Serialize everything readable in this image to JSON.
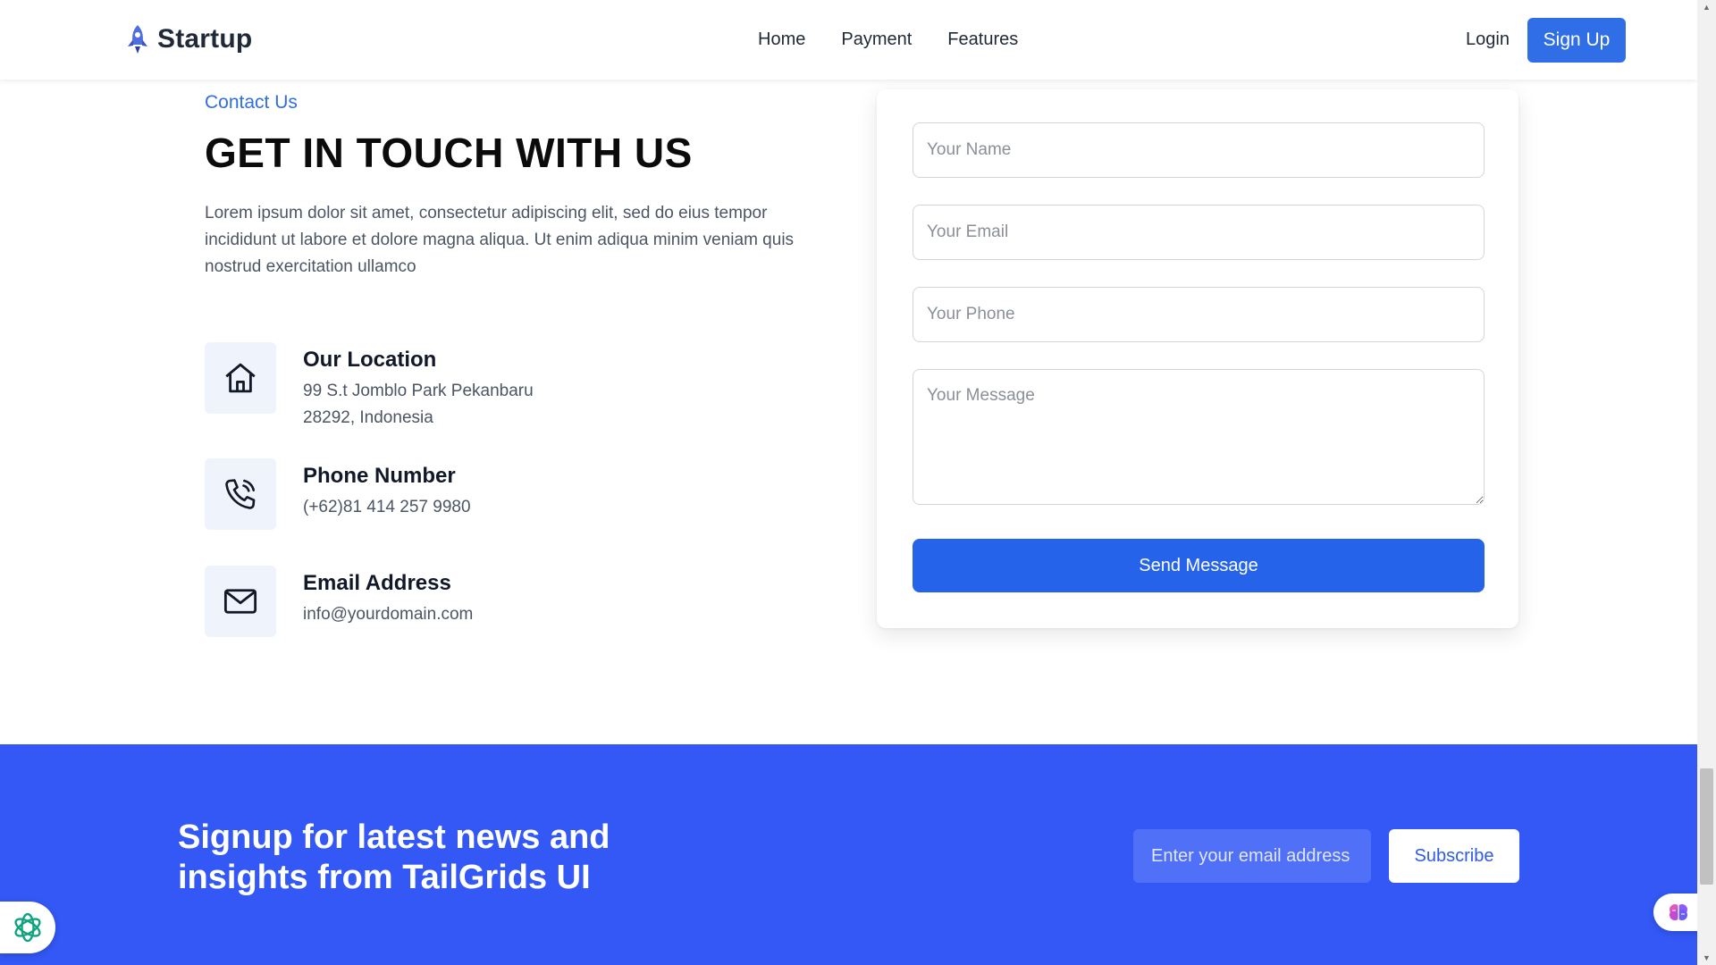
{
  "header": {
    "brand": "Startup",
    "nav": [
      "Home",
      "Payment",
      "Features"
    ],
    "login": "Login",
    "signup": "Sign Up"
  },
  "contact": {
    "eyebrow": "Contact Us",
    "title": "GET IN TOUCH WITH US",
    "description": "Lorem ipsum dolor sit amet, consectetur adipiscing elit, sed do eius tempor incididunt ut labore et dolore magna aliqua. Ut enim adiqua minim veniam quis nostrud exercitation ullamco",
    "items": [
      {
        "icon": "home-icon",
        "title": "Our Location",
        "lines": [
          "99 S.t Jomblo Park Pekanbaru",
          "28292, Indonesia"
        ]
      },
      {
        "icon": "phone-icon",
        "title": "Phone Number",
        "lines": [
          "(+62)81 414 257 9980"
        ]
      },
      {
        "icon": "mail-icon",
        "title": "Email Address",
        "lines": [
          "info@yourdomain.com"
        ]
      }
    ]
  },
  "form": {
    "name_placeholder": "Your Name",
    "email_placeholder": "Your Email",
    "phone_placeholder": "Your Phone",
    "message_placeholder": "Your Message",
    "submit": "Send Message"
  },
  "newsletter": {
    "title": "Signup for latest news and insights from TailGrids UI",
    "email_placeholder": "Enter your email address",
    "button": "Subscribe"
  },
  "colors": {
    "accent": "#2f6ee6",
    "newsletter_bg": "#3358f5",
    "icon_bg": "#eef3fc"
  }
}
